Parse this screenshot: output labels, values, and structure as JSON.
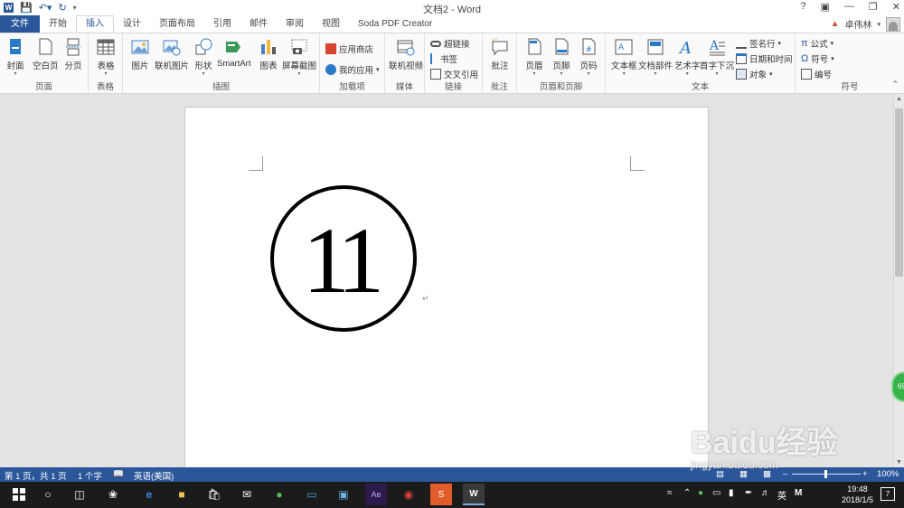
{
  "window": {
    "title": "文档2 - Word",
    "user_name": "卓伟林",
    "controls": [
      "?",
      "▣",
      "—",
      "❐",
      "✕"
    ]
  },
  "tabs": [
    {
      "label": "文件",
      "kind": "file"
    },
    {
      "label": "开始"
    },
    {
      "label": "插入",
      "active": true
    },
    {
      "label": "设计"
    },
    {
      "label": "页面布局"
    },
    {
      "label": "引用"
    },
    {
      "label": "邮件"
    },
    {
      "label": "审阅"
    },
    {
      "label": "视图"
    },
    {
      "label": "Soda PDF Creator"
    }
  ],
  "ribbon": {
    "pages": {
      "label": "页面",
      "cover": "封面",
      "blank": "空白页",
      "break": "分页"
    },
    "tables": {
      "label": "表格",
      "table": "表格"
    },
    "illustrations": {
      "label": "插图",
      "picture": "图片",
      "online_picture": "联机图片",
      "shapes": "形状",
      "smartart": "SmartArt",
      "chart": "图表",
      "screenshot": "屏幕截图"
    },
    "addins": {
      "label": "加载项",
      "store": "应用商店",
      "my_apps": "我的应用"
    },
    "media": {
      "label": "媒体",
      "online_video": "联机视频"
    },
    "links": {
      "label": "链接",
      "hyperlink": "超链接",
      "bookmark": "书签",
      "cross_ref": "交叉引用"
    },
    "comments": {
      "label": "批注",
      "comment": "批注"
    },
    "header_footer": {
      "label": "页眉和页脚",
      "header": "页眉",
      "footer": "页脚",
      "page_number": "页码"
    },
    "text": {
      "label": "文本",
      "textbox": "文本框",
      "quick_parts": "文档部件",
      "wordart": "艺术字",
      "dropcap": "首字下沉",
      "signature": "签名行",
      "datetime": "日期和时间",
      "object": "对象"
    },
    "symbols": {
      "label": "符号",
      "equation": "公式",
      "symbol": "符号",
      "numbering": "编号"
    }
  },
  "document": {
    "content": "11",
    "para_mark": "↵"
  },
  "statusbar": {
    "page": "第 1 页，共 1 页",
    "words": "1 个字",
    "language": "英语(美国)",
    "zoom": "100%"
  },
  "watermark": {
    "logo": "Baidu经验",
    "url": "jingyan.baidu.com"
  },
  "floating_badge": "69",
  "taskbar": {
    "ime": "英",
    "ime2": "M",
    "time": "19:48",
    "date": "2018/1/5",
    "notifications": "7"
  }
}
